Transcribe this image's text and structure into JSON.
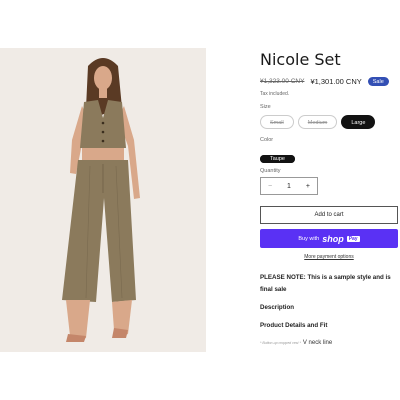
{
  "product": {
    "vendor": "",
    "title": "Nicole Set",
    "old_price": "¥1,323.00 CNY",
    "price": "¥1,301.00 CNY",
    "sale_badge": "Sale",
    "tax_note": "Tax included."
  },
  "size": {
    "label": "Size",
    "options": [
      "Small",
      "Medium",
      "Large"
    ],
    "selected": "Large",
    "unavailable": [
      "Small",
      "Medium"
    ]
  },
  "color": {
    "label": "Color",
    "options": [
      "Taupe"
    ],
    "selected": "Taupe"
  },
  "quantity": {
    "label": "Quantity",
    "value": "1",
    "minus": "−",
    "plus": "+"
  },
  "buttons": {
    "add_to_cart": "Add to cart",
    "buy_with": "Buy with",
    "shop": "shop",
    "pay": "Pay",
    "more_payment": "More payment options"
  },
  "details": {
    "note": "PLEASE NOTE: This is a sample style and is final sale",
    "description": "Description",
    "product_details": "Product Details and Fit",
    "footnote_small": "* Button-up cropped vest *",
    "footnote": "V neck line"
  },
  "colors": {
    "sale_badge": "#334fb4",
    "shop_pay": "#5a31f4",
    "selected_pill": "#121212",
    "garment": "#8b7a5c",
    "photo_bg": "#f0ebe6"
  }
}
